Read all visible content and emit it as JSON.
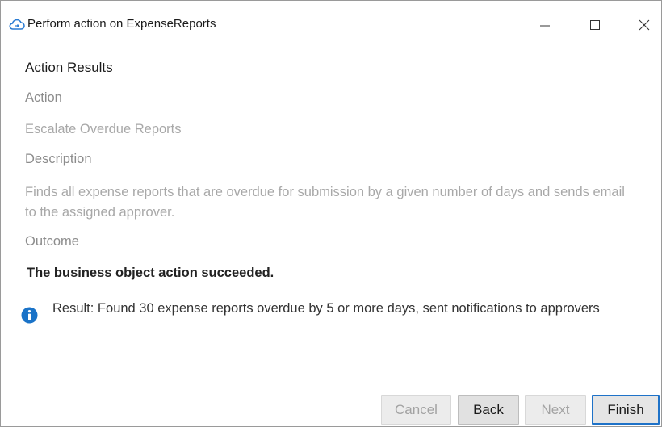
{
  "window": {
    "title": "Perform action on ExpenseReports",
    "controls": {
      "minimize": "—",
      "maximize": "☐",
      "close": "✕"
    }
  },
  "page": {
    "section_title": "Action Results",
    "action_label": "Action",
    "action_value": "Escalate Overdue Reports",
    "description_label": "Description",
    "description_value": "Finds all expense reports that are overdue for submission by a given number of days and sends email to the assigned approver.",
    "outcome_label": "Outcome",
    "outcome_value": "The business object action succeeded.",
    "result_text": "Result: Found 30 expense reports overdue by 5 or more days, sent notifications to approvers"
  },
  "buttons": {
    "cancel": "Cancel",
    "back": "Back",
    "next": "Next",
    "finish": "Finish"
  },
  "colors": {
    "accent": "#1e72c8",
    "info_icon": "#1a73c8"
  }
}
